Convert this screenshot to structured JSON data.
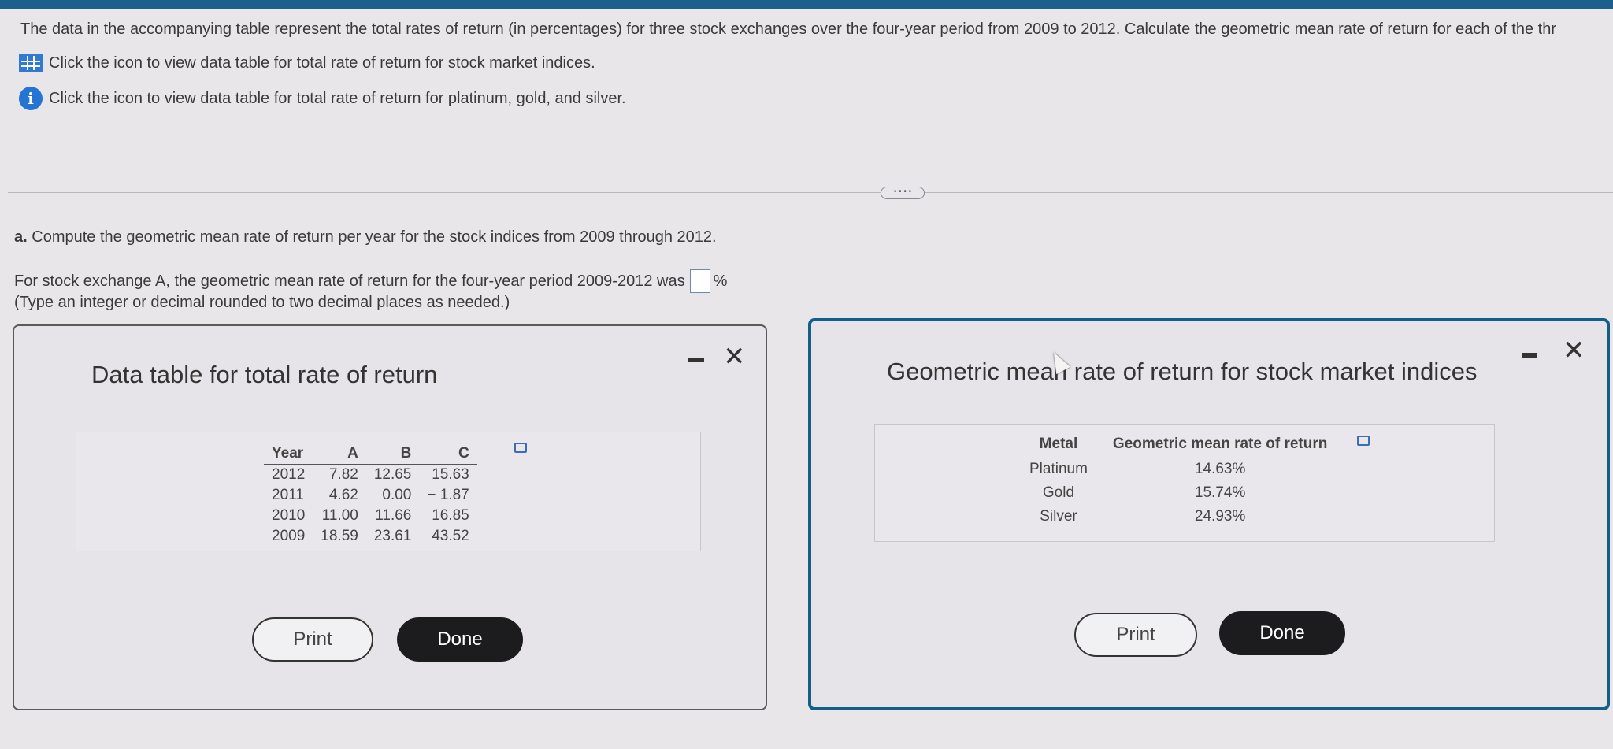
{
  "intro_text": "The data in the accompanying table represent the total rates of return (in percentages) for three stock exchanges over the four-year period from 2009 to 2012. Calculate the geometric mean rate of return for each of the thr",
  "links": [
    {
      "icon": "table-grid-icon",
      "label": "Click the icon to view data table for total rate of return for stock market indices."
    },
    {
      "icon": "info-icon",
      "label": "Click the icon to view data table for total rate of return for platinum, gold, and silver."
    }
  ],
  "expander_label": "• • • •",
  "question": {
    "part_label": "a.",
    "part_text": "Compute the geometric mean rate of return per year for the stock indices from 2009 through 2012.",
    "prompt_text": "For stock exchange A, the geometric mean rate of return for the four-year period 2009-2012 was",
    "unit": "%",
    "hint": "(Type an integer or decimal rounded to two decimal places as needed.)"
  },
  "left_dialog": {
    "title": "Data table for total rate of return",
    "columns": [
      "Year",
      "A",
      "B",
      "C"
    ],
    "rows": [
      [
        "2012",
        "7.82",
        "12.65",
        "15.63"
      ],
      [
        "2011",
        "4.62",
        "0.00",
        "− 1.87"
      ],
      [
        "2010",
        "11.00",
        "11.66",
        "16.85"
      ],
      [
        "2009",
        "18.59",
        "23.61",
        "43.52"
      ]
    ],
    "print_label": "Print",
    "done_label": "Done"
  },
  "right_dialog": {
    "title": "Geometric mean rate of return for stock market indices",
    "columns": [
      "Metal",
      "Geometric mean rate of return"
    ],
    "rows": [
      [
        "Platinum",
        "14.63%"
      ],
      [
        "Gold",
        "15.74%"
      ],
      [
        "Silver",
        "24.93%"
      ]
    ],
    "print_label": "Print",
    "done_label": "Done"
  },
  "window_controls": {
    "close_glyph": "✕"
  }
}
